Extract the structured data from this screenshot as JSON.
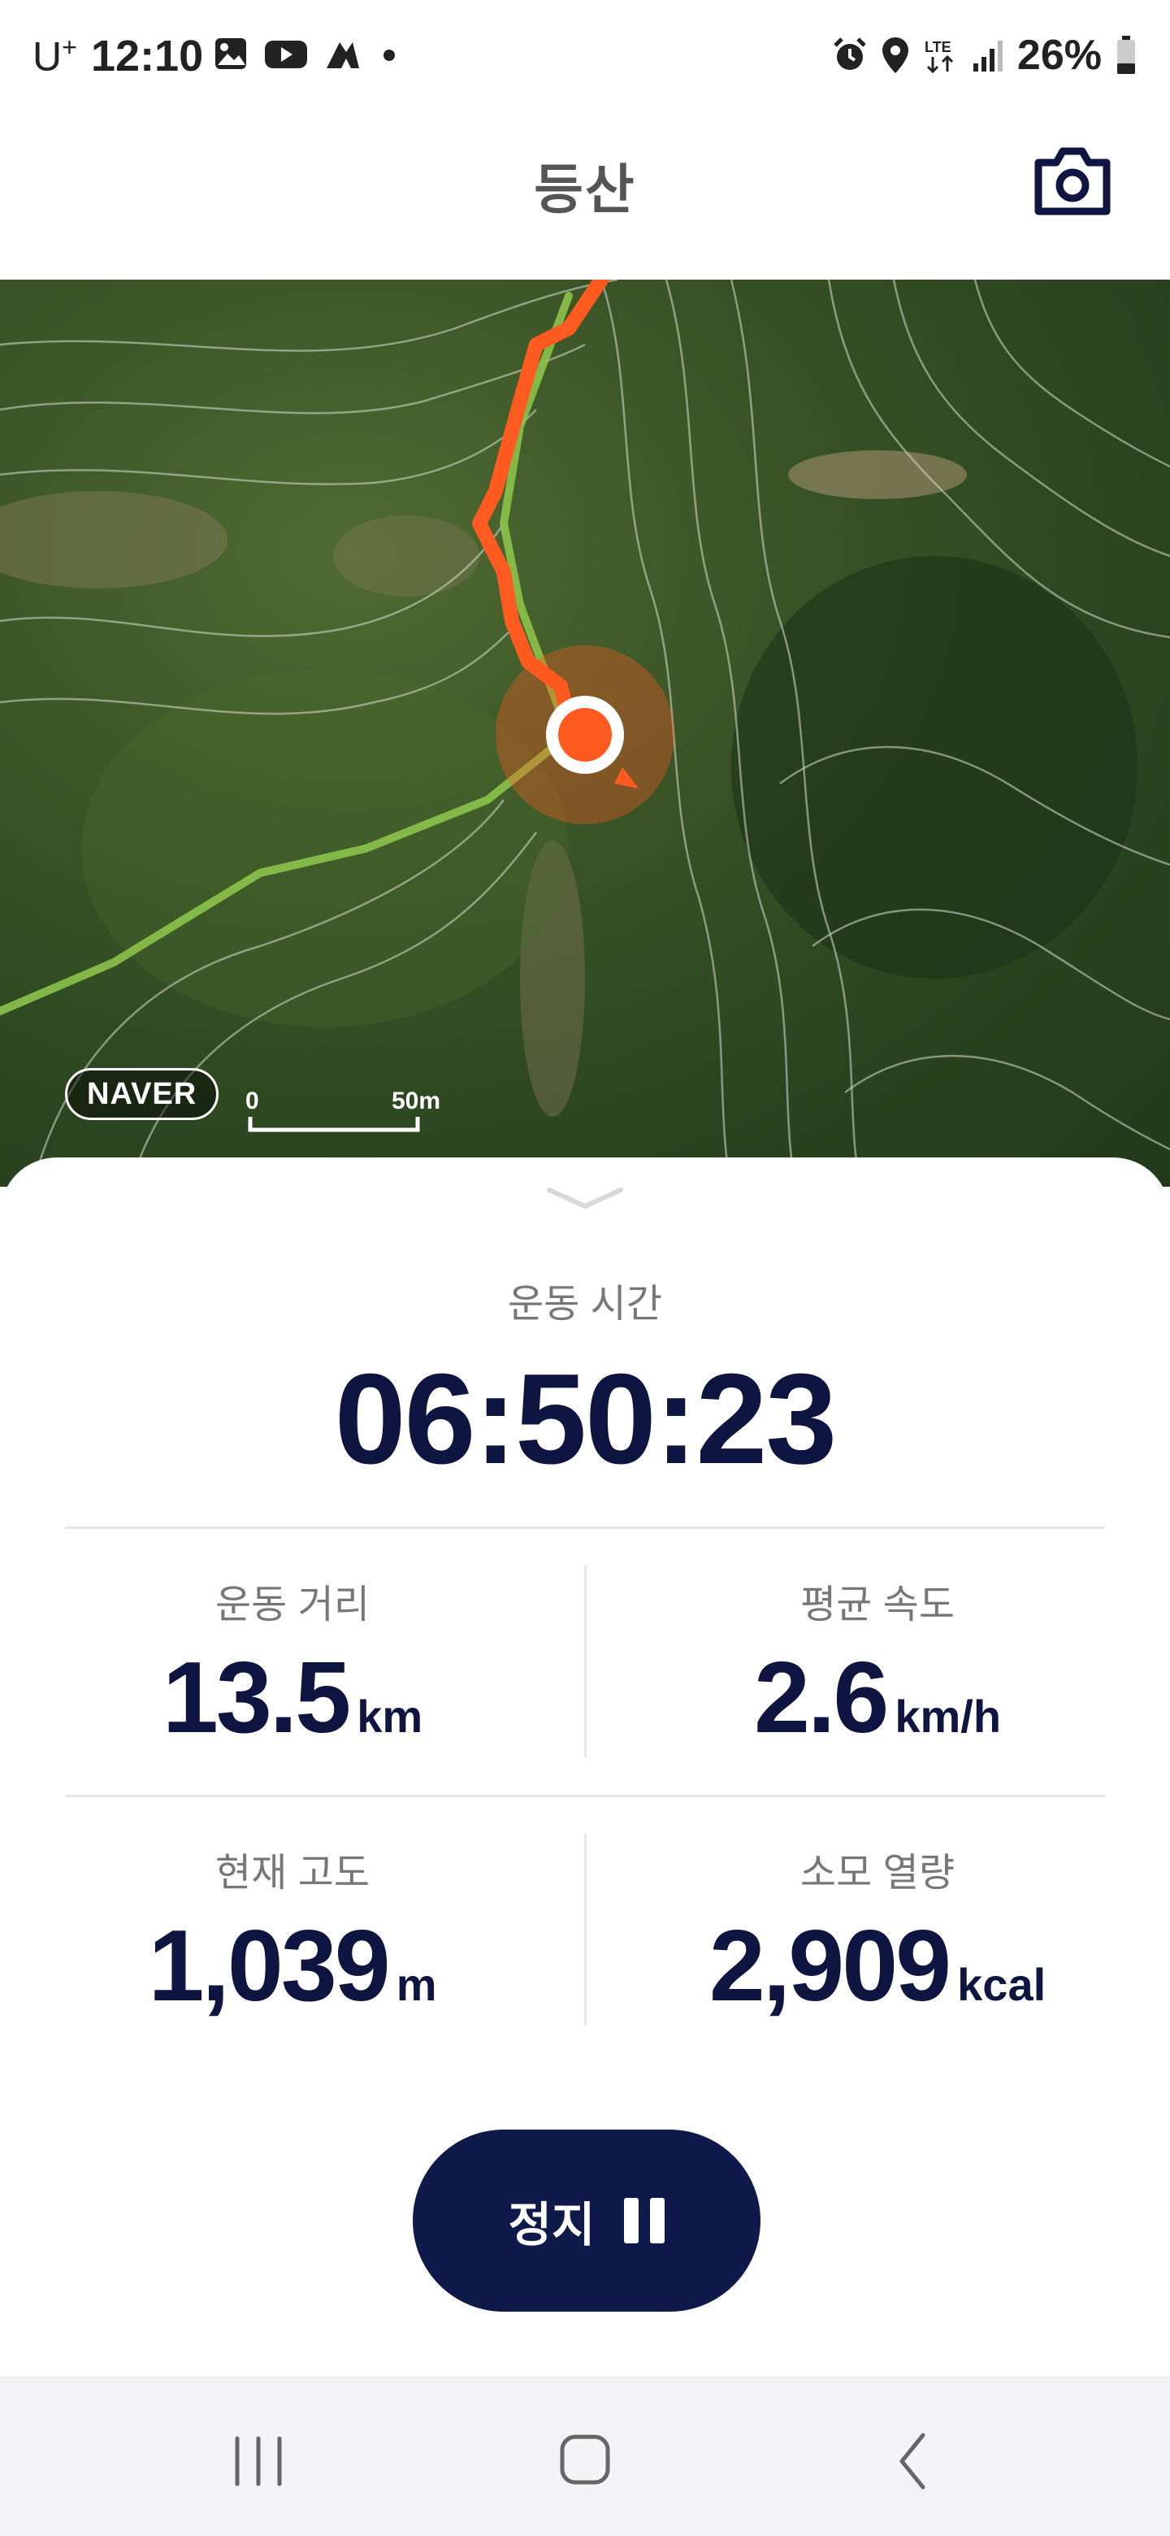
{
  "status_bar": {
    "carrier": "U",
    "carrier_sup": "+",
    "time": "12:10",
    "battery": "26%",
    "left_icons": [
      "gallery-icon",
      "youtube-icon",
      "app-icon",
      "dot-icon"
    ],
    "right_icons": [
      "alarm-icon",
      "location-icon",
      "lte-icon",
      "signal-icon",
      "battery-icon"
    ]
  },
  "header": {
    "title": "등산",
    "camera_icon": "camera-icon"
  },
  "map": {
    "provider": "NAVER",
    "scale_start": "0",
    "scale_end": "50m",
    "track_color": "#ff5a1f",
    "trail_color": "#8bc34a"
  },
  "stats": {
    "time_label": "운동 시간",
    "time_value": "06:50:23",
    "distance": {
      "label": "운동 거리",
      "value": "13.5",
      "unit": "km"
    },
    "avg_speed": {
      "label": "평균 속도",
      "value": "2.6",
      "unit": "km/h"
    },
    "altitude": {
      "label": "현재 고도",
      "value": "1,039",
      "unit": "m"
    },
    "calories": {
      "label": "소모 열량",
      "value": "2,909",
      "unit": "kcal"
    }
  },
  "controls": {
    "stop_label": "정지",
    "stop_icon": "pause-icon"
  },
  "nav_bar": {
    "buttons": [
      "recent-apps-icon",
      "home-icon",
      "back-icon"
    ]
  }
}
